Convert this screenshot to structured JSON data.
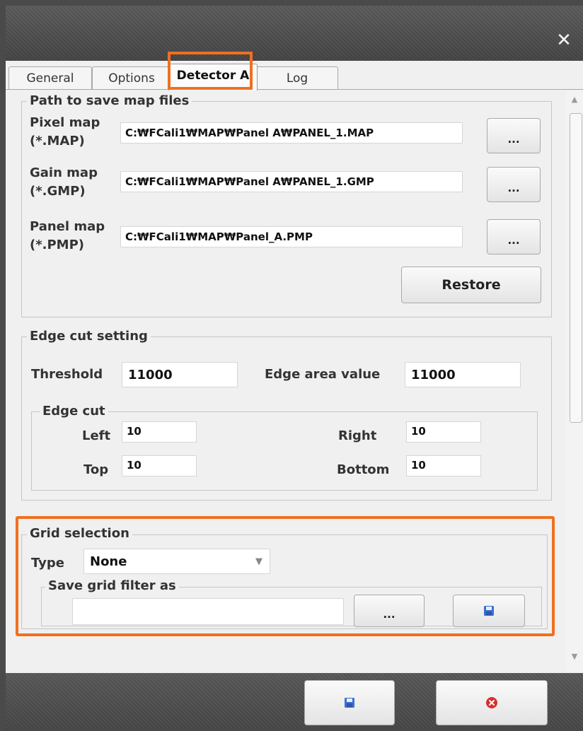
{
  "window": {
    "close_glyph": "✕"
  },
  "tabs": [
    {
      "label": "General"
    },
    {
      "label": "Options"
    },
    {
      "label": "Detector A",
      "active": true
    },
    {
      "label": "Log"
    }
  ],
  "path_group": {
    "title": "Path to save map files",
    "rows": [
      {
        "label_line1": "Pixel map",
        "label_line2": "(*.MAP)",
        "value": "C:₩FCali1₩MAP₩Panel A₩PANEL_1.MAP",
        "browse_label": "..."
      },
      {
        "label_line1": "Gain map",
        "label_line2": "(*.GMP)",
        "value": "C:₩FCali1₩MAP₩Panel A₩PANEL_1.GMP",
        "browse_label": "..."
      },
      {
        "label_line1": "Panel map",
        "label_line2": "(*.PMP)",
        "value": "C:₩FCali1₩MAP₩Panel_A.PMP",
        "browse_label": "..."
      }
    ],
    "restore_label": "Restore"
  },
  "edge_group": {
    "title": "Edge cut setting",
    "threshold_label": "Threshold",
    "threshold_value": "11000",
    "edge_area_label": "Edge area value",
    "edge_area_value": "11000",
    "edge_cut": {
      "title": "Edge cut",
      "left_label": "Left",
      "left_value": "10",
      "right_label": "Right",
      "right_value": "10",
      "top_label": "Top",
      "top_value": "10",
      "bottom_label": "Bottom",
      "bottom_value": "10"
    }
  },
  "grid_group": {
    "title": "Grid selection",
    "type_label": "Type",
    "type_value": "None",
    "save_title": "Save grid filter as",
    "save_value": "",
    "browse_label": "..."
  },
  "colors": {
    "highlight": "#f07020",
    "save_icon": "#3a6fd0",
    "cancel_icon": "#d93030"
  }
}
